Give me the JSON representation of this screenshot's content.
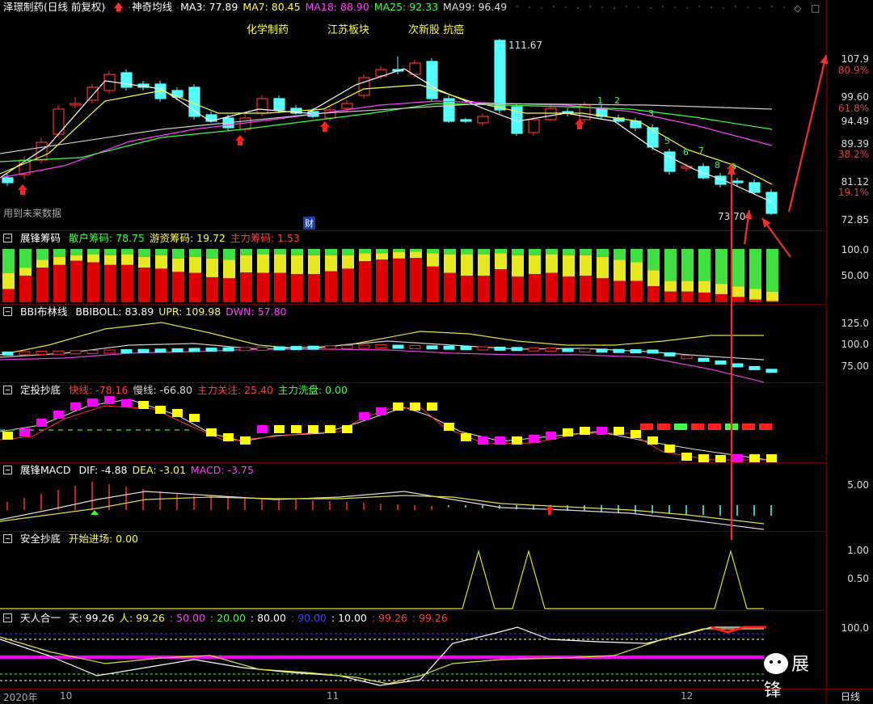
{
  "main": {
    "title": "泽璟制药(日线 前复权)",
    "indicator": "神奇均线",
    "ma": [
      {
        "label": "MA3: 77.89",
        "color": "#ffffff"
      },
      {
        "label": "MA7: 80.45",
        "color": "#ffff40"
      },
      {
        "label": "MA18: 88.90",
        "color": "#ff40ff"
      },
      {
        "label": "MA25: 92.33",
        "color": "#40ff40"
      },
      {
        "label": "MA99: 96.49",
        "color": "#dddddd"
      }
    ],
    "concepts": [
      "化学制药",
      "江苏板块",
      "次新股 抗癌"
    ],
    "high_label": "111.67",
    "low_label": "73.70",
    "future_data_note": "用到未来数据",
    "finance_badge": "财",
    "wave_counts": [
      "1",
      "2",
      "3",
      "5",
      "6",
      "7",
      "8",
      "9"
    ],
    "price_ticks": [
      "107.9",
      "99.60",
      "94.49",
      "89.39",
      "81.12",
      "72.85"
    ],
    "pct_ticks": [
      "80.9%",
      "61.8%",
      "38.2%",
      "19.1%"
    ]
  },
  "chip": {
    "name": "展锋筹码",
    "items": [
      {
        "label": "散户筹码: 78.75",
        "color": "#40ff40"
      },
      {
        "label": "游资筹码: 19.72",
        "color": "#ffff40"
      },
      {
        "label": "主力筹码: 1.53",
        "color": "#ff4040"
      }
    ],
    "ticks": [
      "100.0",
      "50.00"
    ]
  },
  "bbi": {
    "name": "BBI布林线",
    "items": [
      {
        "label": "BBIBOLL: 83.89",
        "color": "#ffffff"
      },
      {
        "label": "UPR: 109.98",
        "color": "#ffff40"
      },
      {
        "label": "DWN: 57.80",
        "color": "#ff40ff"
      }
    ],
    "ticks": [
      "125.0",
      "100.0",
      "75.00"
    ]
  },
  "dingtou": {
    "name": "定投抄底",
    "items": [
      {
        "label": "快线: -78.16",
        "color": "#ff4040"
      },
      {
        "label": "慢线: -66.80",
        "color": "#dddddd"
      },
      {
        "label": "主力关注: 25.40",
        "color": "#ff4040"
      },
      {
        "label": "主力洗盘: 0.00",
        "color": "#40ff40"
      }
    ]
  },
  "macd": {
    "name": "展锋MACD",
    "items": [
      {
        "label": "DIF: -4.88",
        "color": "#ffffff"
      },
      {
        "label": "DEA: -3.01",
        "color": "#ffff40"
      },
      {
        "label": "MACD: -3.75",
        "color": "#ff40ff"
      }
    ],
    "ticks": [
      "5.00"
    ]
  },
  "safe": {
    "name": "安全抄底",
    "items": [
      {
        "label": "开始进场: 0.00",
        "color": "#ffff40"
      }
    ],
    "ticks": [
      "1.00",
      "0.50"
    ]
  },
  "tianren": {
    "name": "天人合一",
    "items": [
      {
        "label": "天: 99.26",
        "color": "#ffffff"
      },
      {
        "label": "人: 99.26",
        "color": "#ffff40"
      },
      {
        "label": ": 50.00",
        "color": "#ff40ff"
      },
      {
        "label": ": 20.00",
        "color": "#40ff40"
      },
      {
        "label": ": 80.00",
        "color": "#ffffff"
      },
      {
        "label": ": 90.00",
        "color": "#4040ff"
      },
      {
        "label": ": 10.00",
        "color": "#ffffff"
      },
      {
        "label": ": 99.26",
        "color": "#ff4040"
      },
      {
        "label": ": 99.26",
        "color": "#ff4040"
      }
    ],
    "ticks": [
      "100.0"
    ]
  },
  "xaxis": {
    "labels": [
      "2020年",
      "10",
      "11",
      "12"
    ],
    "period": "日线"
  },
  "watermark": "展锋"
}
